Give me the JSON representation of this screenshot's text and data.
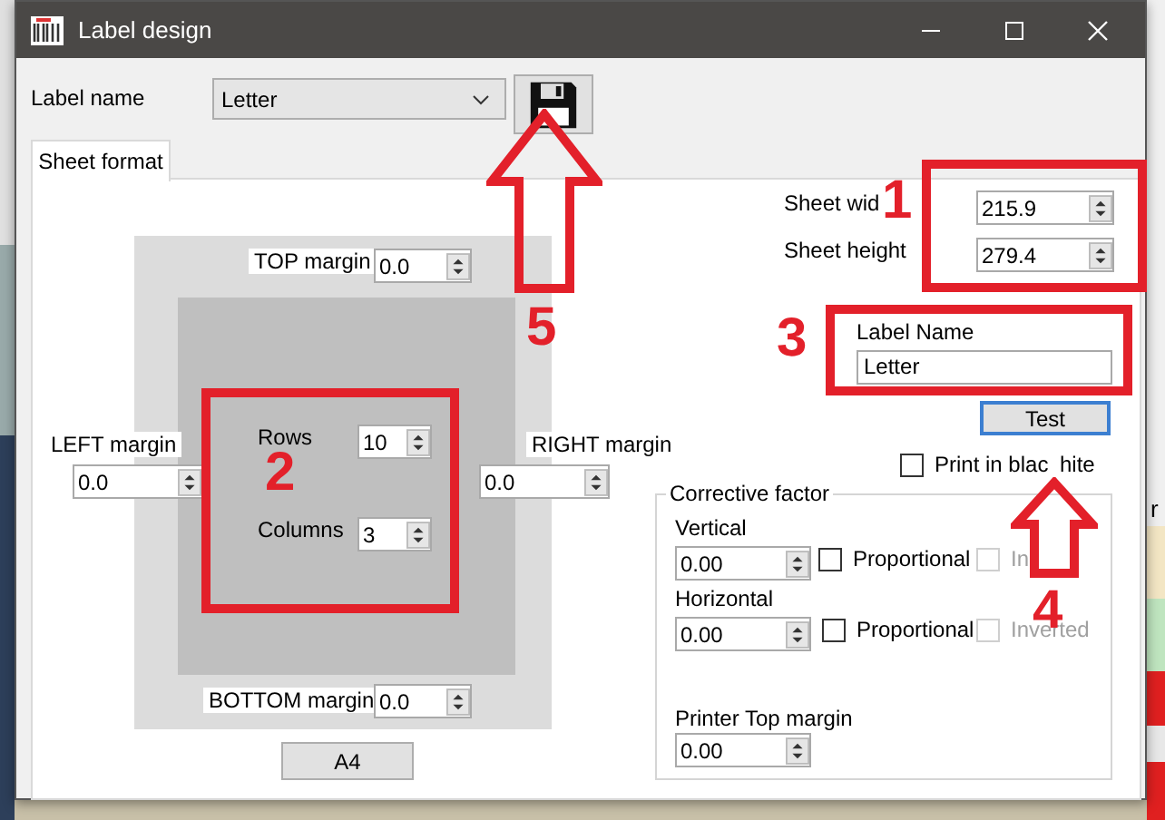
{
  "window": {
    "title": "Label design"
  },
  "label_name": {
    "label": "Label name",
    "value": "Letter"
  },
  "tabs": [
    {
      "label": "Sheet format",
      "selected": true
    }
  ],
  "margins": {
    "top": {
      "label": "TOP margin",
      "value": "0.0"
    },
    "left": {
      "label": "LEFT margin",
      "value": "0.0"
    },
    "right": {
      "label": "RIGHT margin",
      "value": "0.0"
    },
    "bottom": {
      "label": "BOTTOM margin",
      "value": "0.0"
    }
  },
  "grid": {
    "rows": {
      "label": "Rows",
      "value": "10"
    },
    "columns": {
      "label": "Columns",
      "value": "3"
    }
  },
  "a4_button": "A4",
  "sheet_width": {
    "label": "Sheet wid",
    "value": "215.9"
  },
  "sheet_height": {
    "label": "Sheet height",
    "value": "279.4"
  },
  "label_name_field": {
    "label": "Label Name",
    "value": "Letter"
  },
  "test_button": "Test",
  "print_bw": {
    "label": "Print in blac",
    "trailing": "hite",
    "checked": false
  },
  "corrective": {
    "title": "Corrective factor",
    "vertical": {
      "label": "Vertical",
      "value": "0.00",
      "proportional": {
        "label": "Proportional",
        "checked": false
      },
      "inverted": {
        "label": "In",
        "checked": false,
        "disabled": true
      }
    },
    "horizontal": {
      "label": "Horizontal",
      "value": "0.00",
      "proportional": {
        "label": "Proportional",
        "checked": false
      },
      "inverted": {
        "label": "Inverted",
        "checked": false,
        "disabled": true
      }
    },
    "printer_top_margin": {
      "label": "Printer Top margin",
      "value": "0.00"
    }
  },
  "annotations": [
    {
      "kind": "frame"
    },
    {
      "kind": "frame"
    },
    {
      "kind": "frame"
    },
    {
      "kind": "arrow"
    },
    {
      "kind": "arrow"
    },
    {
      "kind": "number",
      "text": "1"
    },
    {
      "kind": "number",
      "text": "2"
    },
    {
      "kind": "number",
      "text": "3"
    },
    {
      "kind": "number",
      "text": "4"
    },
    {
      "kind": "number",
      "text": "5"
    }
  ],
  "background_fragments": [
    "r"
  ]
}
